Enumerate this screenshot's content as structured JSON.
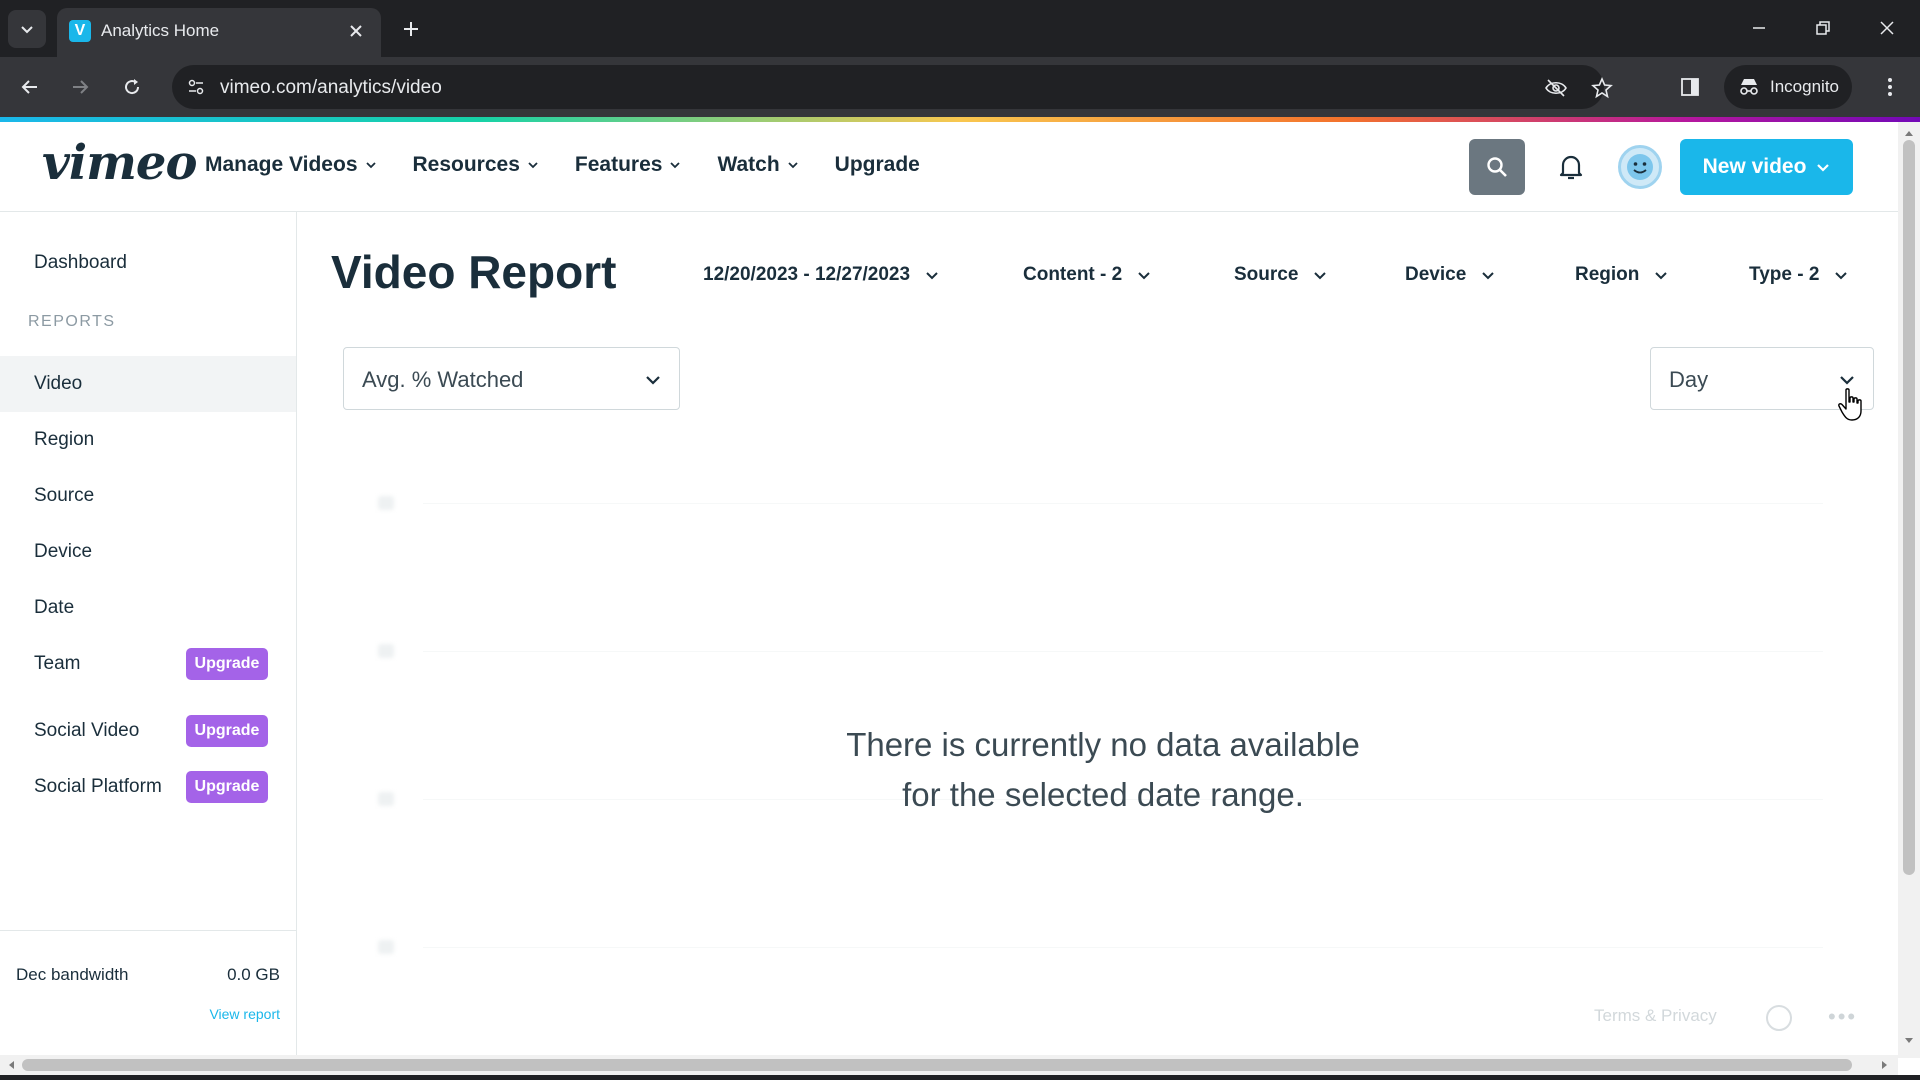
{
  "browser": {
    "tab_title": "Analytics Home",
    "url": "vimeo.com/analytics/video",
    "incognito_label": "Incognito"
  },
  "header": {
    "logo": "vimeo",
    "nav": [
      {
        "label": "Manage Videos"
      },
      {
        "label": "Resources"
      },
      {
        "label": "Features"
      },
      {
        "label": "Watch"
      },
      {
        "label": "Upgrade"
      }
    ],
    "new_video_label": "New video"
  },
  "sidebar": {
    "dashboard": "Dashboard",
    "reports_heading": "REPORTS",
    "items": [
      {
        "label": "Video"
      },
      {
        "label": "Region"
      },
      {
        "label": "Source"
      },
      {
        "label": "Device"
      },
      {
        "label": "Date"
      },
      {
        "label": "Team",
        "badge": "Upgrade"
      },
      {
        "label": "Social Video",
        "badge": "Upgrade"
      },
      {
        "label": "Social Platform",
        "badge": "Upgrade"
      }
    ],
    "bandwidth_label": "Dec bandwidth",
    "bandwidth_value": "0.0 GB",
    "view_report": "View report"
  },
  "main": {
    "title": "Video Report",
    "filters": [
      {
        "label": "12/20/2023 - 12/27/2023"
      },
      {
        "label": "Content - 2"
      },
      {
        "label": "Source"
      },
      {
        "label": "Device"
      },
      {
        "label": "Region"
      },
      {
        "label": "Type - 2"
      }
    ],
    "metric_select": "Avg. % Watched",
    "period_select": "Day",
    "empty_line1": "There is currently no data available",
    "empty_line2": "for the selected date range.",
    "terms": "Terms & Privacy"
  },
  "colors": {
    "accent": "#1ab7ea",
    "badge": "#a463e8",
    "text": "#1a2e3b"
  }
}
